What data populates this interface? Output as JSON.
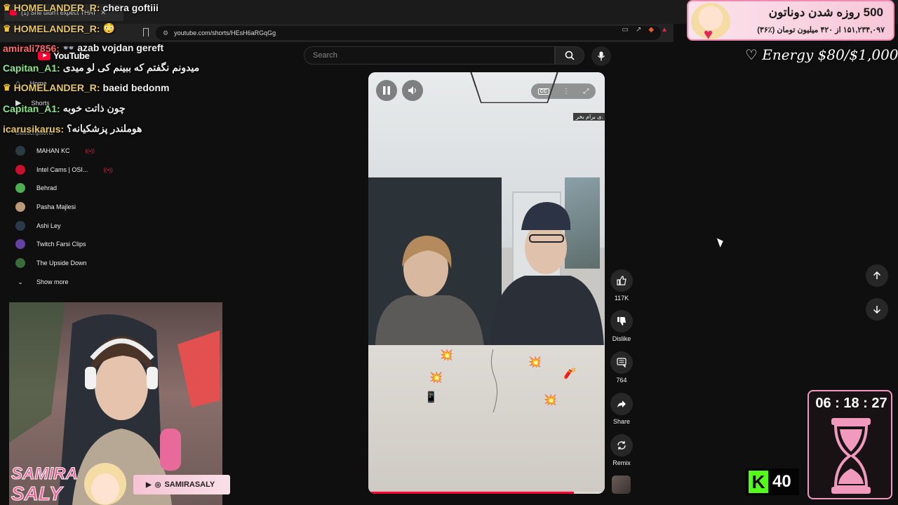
{
  "browser": {
    "tab_title": "(1) She didn't expect THAT",
    "url": "youtube.com/shorts/HEsH6aRGqGg"
  },
  "youtube": {
    "logo_text": "YouTube",
    "search_placeholder": "Search",
    "nav": [
      {
        "label": "Home",
        "icon": "home-icon"
      },
      {
        "label": "Shorts",
        "icon": "shorts-icon"
      }
    ],
    "subscriptions_title": "Subscriptions",
    "subscriptions": [
      {
        "name": "MAHAN KC",
        "live": true,
        "color": "#2b3a44"
      },
      {
        "name": "Intel Cams | OSI...",
        "live": true,
        "color": "#c8102e"
      },
      {
        "name": "Behrad",
        "live": false,
        "color": "#4caf50"
      },
      {
        "name": "Pasha Majlesi",
        "live": false,
        "color": "#b99a7a"
      },
      {
        "name": "Ashi Ley",
        "live": false,
        "color": "#2a3a4a"
      },
      {
        "name": "Twitch Farsi Clips",
        "live": false,
        "color": "#6441a5"
      },
      {
        "name": "The Upside Down",
        "live": false,
        "color": "#3a6b3a"
      }
    ],
    "show_more": "Show more"
  },
  "short": {
    "caption": "ی برام بخر.",
    "progress_fraction": 0.87,
    "actions": {
      "likes": "117K",
      "dislike_label": "Dislike",
      "comments": "764",
      "share_label": "Share",
      "remix_label": "Remix"
    }
  },
  "chat": [
    {
      "user": "HOMELANDER_R:",
      "msg": "chera goftiii",
      "crown": true,
      "user_class": "gold"
    },
    {
      "user": "HOMELANDER_R:",
      "msg": "😳",
      "crown": true,
      "user_class": "gold"
    },
    {
      "user": "amirali7856:",
      "msg": "👓 azab vojdan gereft",
      "crown": false,
      "user_class": "red"
    },
    {
      "user": "Capitan_A1:",
      "msg": "میدونم نگفتم که ببینم کی لو میدی",
      "crown": false,
      "user_class": "green"
    },
    {
      "user": "HOMELANDER_R:",
      "msg": "baeid bedonm",
      "crown": true,
      "user_class": "gold"
    },
    {
      "user": "Capitan_A1:",
      "msg": "چون ذاتت خوبه",
      "crown": false,
      "user_class": "green"
    },
    {
      "user": "icarusikarus:",
      "msg": "هوملندر پزشکیانه؟",
      "crown": false,
      "user_class": "gold"
    }
  ],
  "overlay": {
    "donation_title": "500 روزه شدن دوناتون",
    "donation_sub": "۱۵۱,۲۳۴,۰۹۷ از ۴۲۰ میلیون تومان (٪۳۶)",
    "energy": "♡ Energy $80/$1,000",
    "timer": "06 : 18 : 27",
    "kick_count": "40",
    "handle": "SAMIRASALY",
    "streamer": "SAMIRA SALY"
  }
}
